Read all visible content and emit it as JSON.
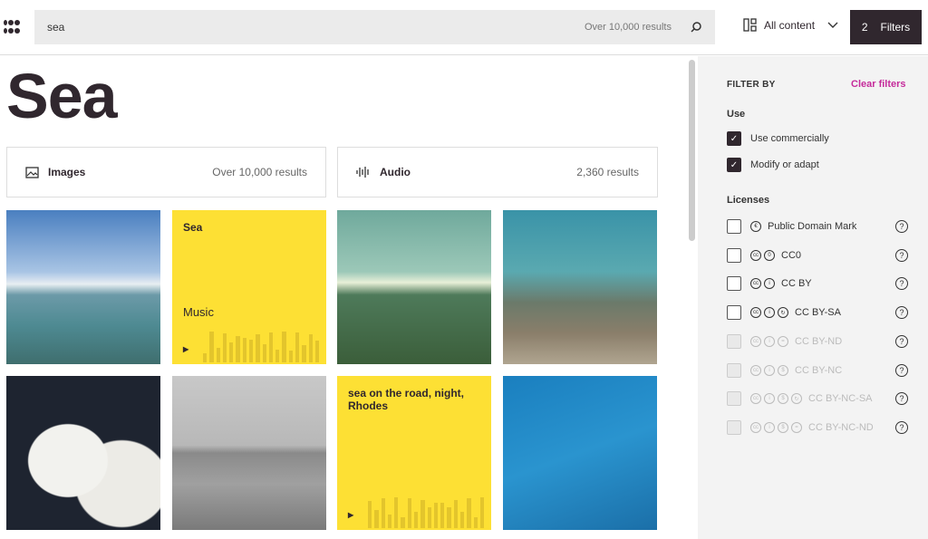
{
  "header": {
    "search_value": "sea",
    "result_count": "Over 10,000 results",
    "content_type": "All content",
    "filter_count": "2",
    "filters_label": "Filters"
  },
  "main": {
    "title": "Sea",
    "cards": [
      {
        "label": "Images",
        "count": "Over 10,000 results",
        "icon": "image-icon"
      },
      {
        "label": "Audio",
        "count": "2,360 results",
        "icon": "audio-waveform-icon"
      }
    ],
    "results": [
      {
        "type": "image",
        "alt": "pier-lake-mountains"
      },
      {
        "type": "audio",
        "title": "Sea",
        "genre": "Music"
      },
      {
        "type": "image",
        "alt": "green-sea-sun"
      },
      {
        "type": "image",
        "alt": "sea-turtle-reef"
      },
      {
        "type": "image",
        "alt": "salt-piles"
      },
      {
        "type": "image",
        "alt": "child-running-beach"
      },
      {
        "type": "audio",
        "title": "sea on the road, night, Rhodes",
        "genre": ""
      },
      {
        "type": "image",
        "alt": "sea-turtle-swimming"
      }
    ]
  },
  "sidebar": {
    "heading": "FILTER BY",
    "clear_label": "Clear filters",
    "accent": "#c52b9b",
    "use_heading": "Use",
    "use": [
      {
        "label": "Use commercially",
        "checked": true
      },
      {
        "label": "Modify or adapt",
        "checked": true
      }
    ],
    "licenses_heading": "Licenses",
    "licenses": [
      {
        "label": "Public Domain Mark",
        "icons": [
          "pdm"
        ],
        "disabled": false
      },
      {
        "label": "CC0",
        "icons": [
          "cc",
          "zero"
        ],
        "disabled": false
      },
      {
        "label": "CC BY",
        "icons": [
          "cc",
          "by"
        ],
        "disabled": false
      },
      {
        "label": "CC BY-SA",
        "icons": [
          "cc",
          "by",
          "sa"
        ],
        "disabled": false
      },
      {
        "label": "CC BY-ND",
        "icons": [
          "cc",
          "by",
          "nd"
        ],
        "disabled": true
      },
      {
        "label": "CC BY-NC",
        "icons": [
          "cc",
          "by",
          "nc"
        ],
        "disabled": true
      },
      {
        "label": "CC BY-NC-SA",
        "icons": [
          "cc",
          "by",
          "nc",
          "sa"
        ],
        "disabled": true
      },
      {
        "label": "CC BY-NC-ND",
        "icons": [
          "cc",
          "by",
          "nc",
          "nd"
        ],
        "disabled": true
      }
    ]
  }
}
